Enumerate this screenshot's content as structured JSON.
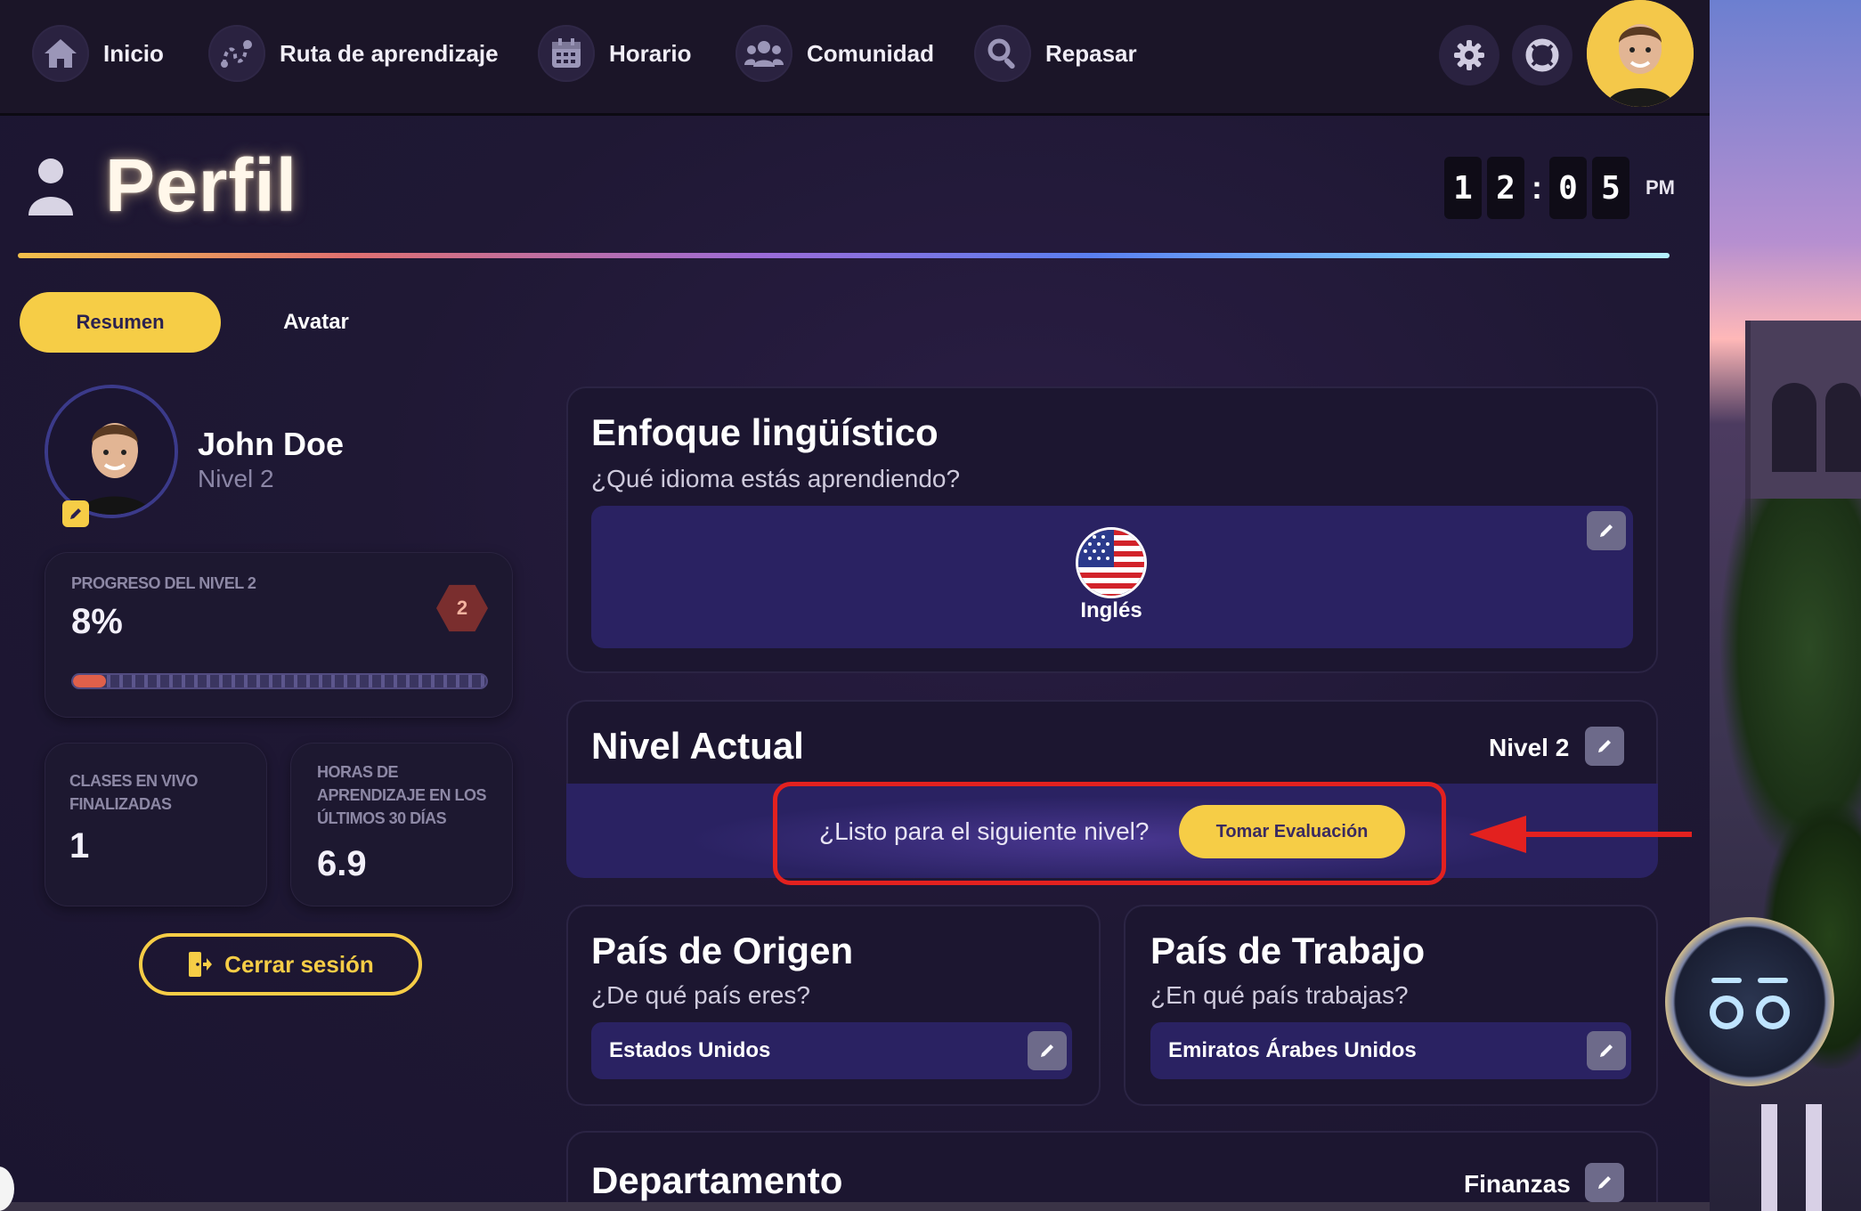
{
  "nav": {
    "items": [
      {
        "label": "Inicio",
        "icon": "home-icon"
      },
      {
        "label": "Ruta de aprendizaje",
        "icon": "route-icon"
      },
      {
        "label": "Horario",
        "icon": "calendar-icon"
      },
      {
        "label": "Comunidad",
        "icon": "people-icon"
      },
      {
        "label": "Repasar",
        "icon": "search-icon"
      }
    ],
    "settings_icon": "gear-icon",
    "help_icon": "lifebuoy-icon",
    "avatar_icon": "user-avatar"
  },
  "header": {
    "title": "Perfil",
    "clock": {
      "d1": "1",
      "d2": "2",
      "sep": ":",
      "d3": "0",
      "d4": "5",
      "ampm": "PM"
    }
  },
  "tabs": [
    {
      "label": "Resumen",
      "active": true
    },
    {
      "label": "Avatar",
      "active": false
    }
  ],
  "profile": {
    "name": "John Doe",
    "level": "Nivel 2"
  },
  "progress": {
    "label": "PROGRESO DEL NIVEL 2",
    "percent_text": "8%",
    "percent": 8,
    "badge": "2"
  },
  "stats": [
    {
      "label": "CLASES EN VIVO FINALIZADAS",
      "value": "1"
    },
    {
      "label": "HORAS DE APRENDIZAJE EN LOS ÚLTIMOS 30 DÍAS",
      "value": "6.9"
    }
  ],
  "logout": {
    "label": "Cerrar sesión"
  },
  "language": {
    "title": "Enfoque lingüístico",
    "subtitle": "¿Qué idioma estás aprendiendo?",
    "value": "Inglés"
  },
  "current_level": {
    "title": "Nivel Actual",
    "value": "Nivel 2",
    "prompt": "¿Listo para el siguiente nivel?",
    "button": "Tomar Evaluación"
  },
  "origin": {
    "title": "País de Origen",
    "subtitle": "¿De qué país eres?",
    "value": "Estados Unidos"
  },
  "work": {
    "title": "País de Trabajo",
    "subtitle": "¿En qué país trabajas?",
    "value": "Emiratos Árabes Unidos"
  },
  "department": {
    "title": "Departamento",
    "value": "Finanzas"
  },
  "colors": {
    "accent": "#f6cd46",
    "annotation": "#e3211f",
    "panel": "#1c1630"
  }
}
